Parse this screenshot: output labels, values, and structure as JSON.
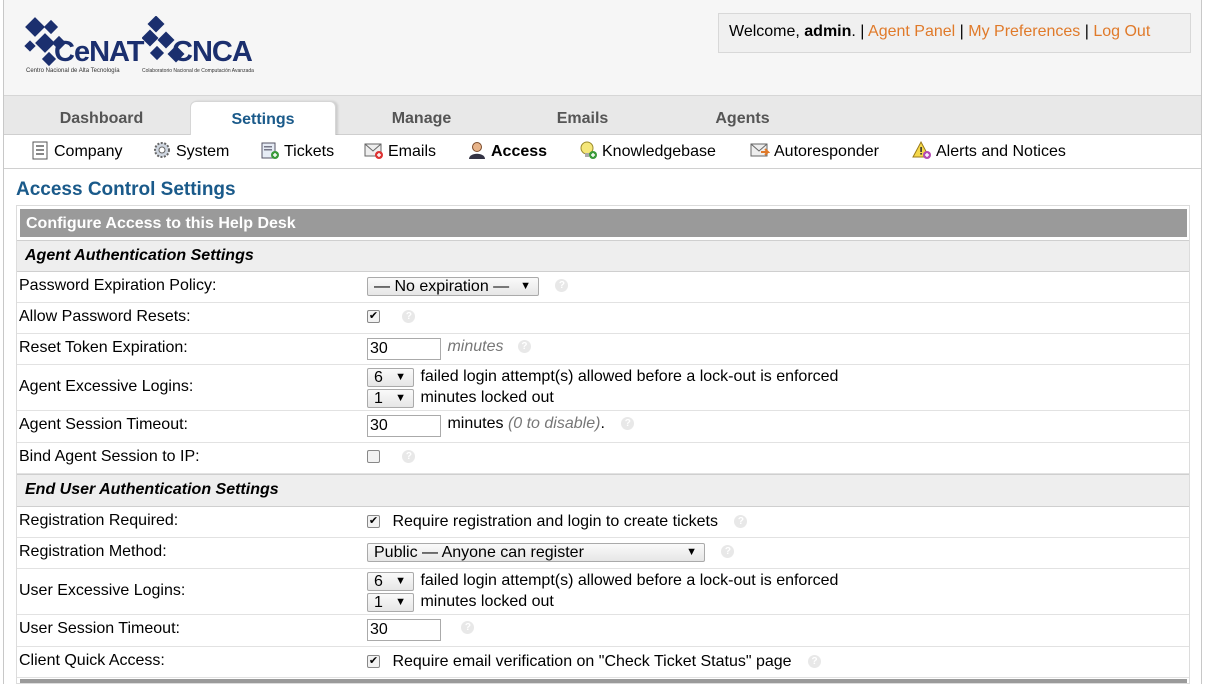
{
  "header": {
    "logo1": {
      "name": "CeNAT",
      "subtitle": "Centro Nacional de Alta Tecnología"
    },
    "logo2": {
      "name": "CNCA",
      "subtitle": "Colaboratorio Nacional de Computación Avanzada"
    },
    "welcome_prefix": "Welcome, ",
    "username": "admin",
    "welcome_suffix": ". | ",
    "agent_panel": "Agent Panel",
    "sep1": " | ",
    "my_preferences": "My Preferences",
    "sep2": " | ",
    "log_out": "Log Out"
  },
  "nav": {
    "tabs": [
      {
        "label": "Dashboard"
      },
      {
        "label": "Settings"
      },
      {
        "label": "Manage"
      },
      {
        "label": "Emails"
      },
      {
        "label": "Agents"
      }
    ],
    "active_tab": "Settings"
  },
  "subnav": {
    "items": [
      {
        "label": "Company",
        "icon": "company-icon"
      },
      {
        "label": "System",
        "icon": "system-gear-icon"
      },
      {
        "label": "Tickets",
        "icon": "tickets-icon"
      },
      {
        "label": "Emails",
        "icon": "emails-icon"
      },
      {
        "label": "Access",
        "icon": "access-user-icon"
      },
      {
        "label": "Knowledgebase",
        "icon": "knowledgebase-icon"
      },
      {
        "label": "Autoresponder",
        "icon": "autoresponder-icon"
      },
      {
        "label": "Alerts and Notices",
        "icon": "alerts-icon"
      }
    ],
    "active_item": "Access"
  },
  "page": {
    "title": "Access Control Settings",
    "table_header": "Configure Access to this Help Desk",
    "agent_section": "Agent Authentication Settings",
    "end_user_section": "End User Authentication Settings"
  },
  "agent": {
    "password_expiration": {
      "label": "Password Expiration Policy:",
      "value": "— No expiration —"
    },
    "allow_password_resets": {
      "label": "Allow Password Resets:",
      "checked": true
    },
    "reset_token_expiration": {
      "label": "Reset Token Expiration:",
      "value": "30",
      "unit": "minutes"
    },
    "excessive_logins": {
      "label": "Agent Excessive Logins:",
      "attempts": "6",
      "attempts_text": "failed login attempt(s) allowed before a lock-out is enforced",
      "lockout": "1",
      "lockout_text": "minutes locked out"
    },
    "session_timeout": {
      "label": "Agent Session Timeout:",
      "value": "30",
      "unit": "minutes",
      "hint": "(0 to disable)",
      "period": "."
    },
    "bind_session_ip": {
      "label": "Bind Agent Session to IP:",
      "checked": false
    }
  },
  "end_user": {
    "registration_required": {
      "label": "Registration Required:",
      "checked": true,
      "text": "Require registration and login to create tickets"
    },
    "registration_method": {
      "label": "Registration Method:",
      "value": "Public — Anyone can register"
    },
    "excessive_logins": {
      "label": "User Excessive Logins:",
      "attempts": "6",
      "attempts_text": "failed login attempt(s) allowed before a lock-out is enforced",
      "lockout": "1",
      "lockout_text": "minutes locked out"
    },
    "session_timeout": {
      "label": "User Session Timeout:",
      "value": "30"
    },
    "client_quick_access": {
      "label": "Client Quick Access:",
      "checked": true,
      "text": "Require email verification on \"Check Ticket Status\" page"
    }
  },
  "colors": {
    "accent": "#1a5a8a",
    "link": "#e07a2a",
    "header_bar": "#9a9a9a"
  }
}
